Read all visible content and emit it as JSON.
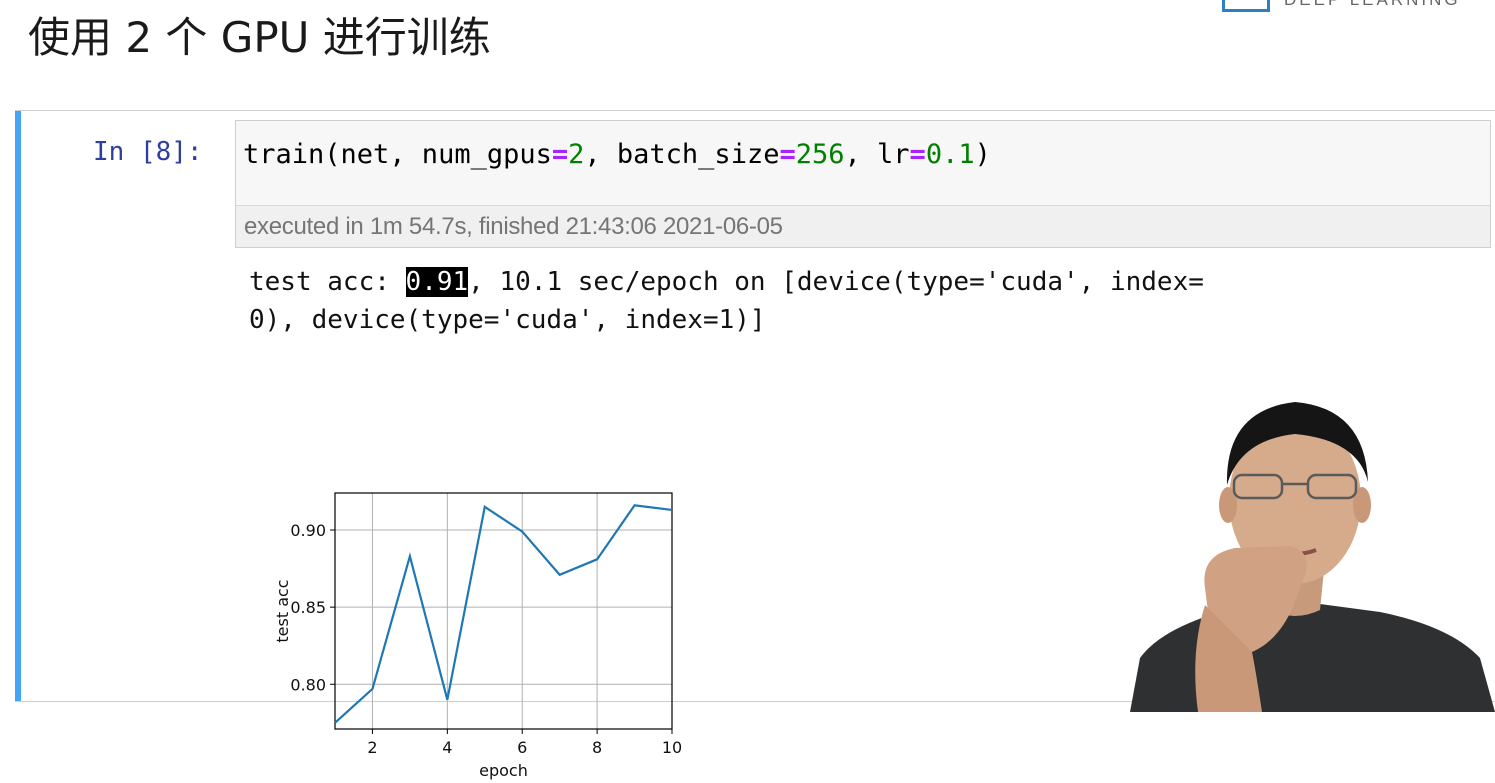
{
  "slide": {
    "title": "使用 2 个 GPU 进行训练",
    "logo_text": "DEEP LEARNING"
  },
  "cell": {
    "prompt": "In [8]:",
    "code_tokens": [
      {
        "text": "train(net, num_gpus",
        "kind": "plain"
      },
      {
        "text": "=",
        "kind": "op"
      },
      {
        "text": "2",
        "kind": "num"
      },
      {
        "text": ", batch_size",
        "kind": "plain"
      },
      {
        "text": "=",
        "kind": "op"
      },
      {
        "text": "256",
        "kind": "num"
      },
      {
        "text": ", lr",
        "kind": "plain"
      },
      {
        "text": "=",
        "kind": "op"
      },
      {
        "text": "0.1",
        "kind": "num"
      },
      {
        "text": ")",
        "kind": "plain"
      }
    ],
    "execution_info": "executed in 1m 54.7s, finished 21:43:06 2021-06-05",
    "output": {
      "prefix": "test acc: ",
      "highlight": "0.91",
      "rest_line1": ", 10.1 sec/epoch on [device(type='cuda', index=",
      "line2": "0), device(type='cuda', index=1)]"
    }
  },
  "colors": {
    "cell_bar": "#42a5f5",
    "prompt": "#303f9f",
    "operator": "#aa22ff",
    "number": "#008000",
    "line": "#1f77b4"
  },
  "chart_data": {
    "type": "line",
    "title": "",
    "xlabel": "epoch",
    "ylabel": "test acc",
    "x": [
      1,
      2,
      3,
      4,
      5,
      6,
      7,
      8,
      9,
      10
    ],
    "series": [
      {
        "values": [
          0.775,
          0.797,
          0.883,
          0.79,
          0.915,
          0.899,
          0.871,
          0.881,
          0.916,
          0.913
        ]
      }
    ],
    "xlim": [
      1,
      10
    ],
    "ylim": [
      0.771,
      0.924
    ],
    "xticks": [
      2,
      4,
      6,
      8,
      10
    ],
    "yticks": [
      0.8,
      0.85,
      0.9
    ],
    "ytick_labels": [
      "0.80",
      "0.85",
      "0.90"
    ],
    "grid": true
  }
}
